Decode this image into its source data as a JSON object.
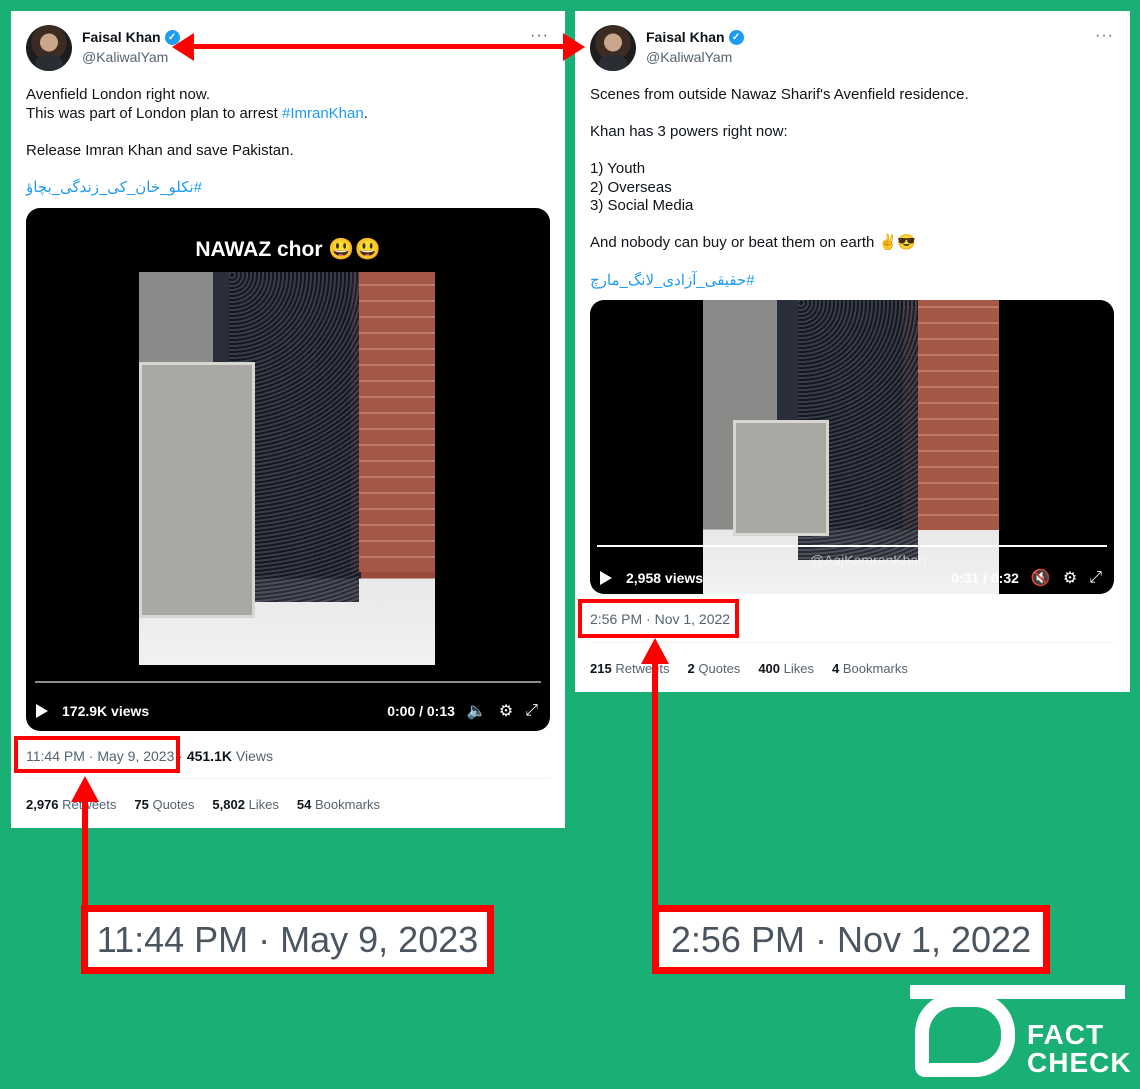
{
  "tweets": [
    {
      "author_name": "Faisal Khan",
      "author_handle": "@KaliwalYam",
      "more": "···",
      "text_line1": "Avenfield London right now.",
      "text_line2_prefix": "This was part of London plan to arrest ",
      "text_line2_link": "#ImranKhan",
      "text_line2_suffix": ".",
      "text_line3": "Release Imran Khan and save Pakistan.",
      "hashtag": "#نکلو_خان_کی_زندگی_بچاؤ",
      "video_overlay_title": "NAWAZ chor 😃😃",
      "views_label": "172.9K views",
      "time_label": "0:00 / 0:13",
      "timestamp": "11:44 PM · May 9, 2023",
      "view_count": "451.1K",
      "view_word": "Views",
      "stats": [
        {
          "value": "2,976",
          "label": "Retweets"
        },
        {
          "value": "75",
          "label": "Quotes"
        },
        {
          "value": "5,802",
          "label": "Likes"
        },
        {
          "value": "54",
          "label": "Bookmarks"
        }
      ]
    },
    {
      "author_name": "Faisal Khan",
      "author_handle": "@KaliwalYam",
      "more": "···",
      "text_line1": "Scenes from outside Nawaz Sharif's Avenfield residence.",
      "text_line2": "Khan has 3 powers right now:",
      "list": [
        "1) Youth",
        "2) Overseas",
        "3) Social Media"
      ],
      "text_line3": "And nobody can buy or beat them on earth ✌️😎",
      "hashtag": "#حقیقی_آزادی_لانگ_مارچ",
      "video_watermark": "@AajKamranKhan",
      "views_label": "2,958 views",
      "time_label": "0:31 / 0:32",
      "timestamp": "2:56 PM · Nov 1, 2022",
      "stats": [
        {
          "value": "215",
          "label": "Retweets"
        },
        {
          "value": "2",
          "label": "Quotes"
        },
        {
          "value": "400",
          "label": "Likes"
        },
        {
          "value": "4",
          "label": "Bookmarks"
        }
      ]
    }
  ],
  "callouts": {
    "left": "11:44 PM · May 9, 2023",
    "right": "2:56 PM · Nov 1, 2022"
  },
  "logo": {
    "line1": "FACT",
    "line2": "CHECK"
  },
  "colors": {
    "background": "#1aaf74",
    "highlight": "#ff0000",
    "link": "#1d9bf0"
  }
}
